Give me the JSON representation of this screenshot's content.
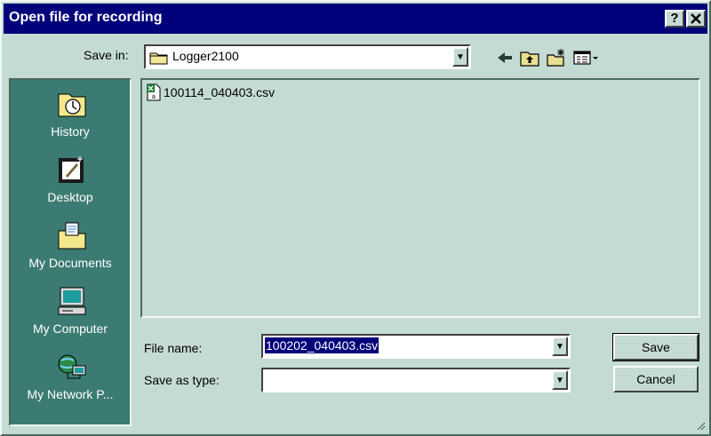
{
  "window": {
    "title": "Open file for recording",
    "help_label": "?",
    "close_label": "X"
  },
  "save_in": {
    "label": "Save in:",
    "value": "Logger2100"
  },
  "toolbar": {
    "icons": [
      "back-arrow-icon",
      "up-folder-icon",
      "new-folder-icon",
      "view-menu-icon"
    ]
  },
  "places": [
    {
      "label": "History",
      "icon": "history-icon"
    },
    {
      "label": "Desktop",
      "icon": "desktop-icon"
    },
    {
      "label": "My Documents",
      "icon": "my-documents-icon"
    },
    {
      "label": "My Computer",
      "icon": "my-computer-icon"
    },
    {
      "label": "My Network P...",
      "icon": "network-places-icon"
    }
  ],
  "files": [
    {
      "name": "100114_040403.csv",
      "icon": "csv-file-icon"
    }
  ],
  "file_name": {
    "label": "File name:",
    "value": "100202_040403.csv"
  },
  "save_as_type": {
    "label": "Save as type:",
    "value": ""
  },
  "buttons": {
    "save": "Save",
    "cancel": "Cancel"
  },
  "colors": {
    "titlebar": "#00007a",
    "face": "#c4dbd3",
    "places_bar": "#3b7b73",
    "selection": "#00007a"
  }
}
